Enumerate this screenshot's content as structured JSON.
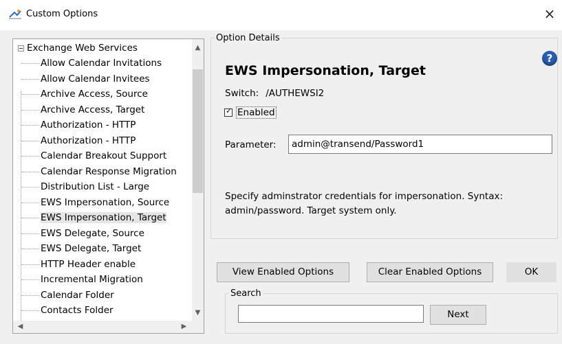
{
  "window": {
    "title": "Custom Options",
    "close_glyph": "×"
  },
  "tree": {
    "root_label": "Exchange Web Services",
    "items": [
      "Allow Calendar Invitations",
      "Allow Calendar Invitees",
      "Archive Access, Source",
      "Archive Access, Target",
      "Authorization - HTTP",
      "Authorization - HTTP",
      "Calendar Breakout Support",
      "Calendar Response Migration",
      "Distribution List - Large",
      "EWS Impersonation, Source",
      "EWS Impersonation, Target",
      "EWS Delegate, Source",
      "EWS Delegate, Target",
      "HTTP Header enable",
      "Incremental Migration",
      "Calendar Folder",
      "Contacts Folder"
    ],
    "selected_index": 10,
    "scroll_up": "▲",
    "scroll_down": "▼",
    "scroll_left": "◀",
    "scroll_right": "▶"
  },
  "details": {
    "legend": "Option Details",
    "help_glyph": "?",
    "title": "EWS Impersonation, Target",
    "switch_label": "Switch:",
    "switch_value": "/AUTHEWSI2",
    "enabled_label": "Enabled",
    "enabled_checked": true,
    "parameter_label": "Parameter:",
    "parameter_value": "admin@transend/Password1",
    "description": "Specify adminstrator credentials for impersonation. Syntax: admin/password. Target system only."
  },
  "buttons": {
    "view_enabled": "View Enabled Options",
    "clear_enabled": "Clear Enabled Options",
    "ok": "OK",
    "next": "Next"
  },
  "search": {
    "legend": "Search",
    "value": ""
  },
  "colors": {
    "help_icon": "#2b5fb4",
    "selection_bg": "#e5e5e5",
    "window_bg": "#f0f0f0"
  }
}
